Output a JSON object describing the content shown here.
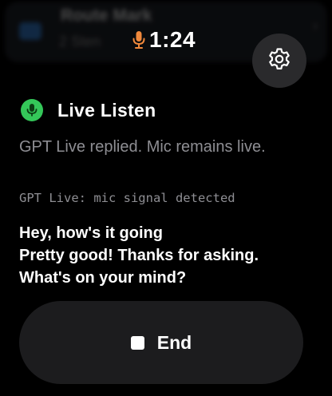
{
  "background_app": {
    "title": "Route Mark",
    "subtitle": "2 Sten",
    "chevron": "›"
  },
  "status": {
    "time": "1:24",
    "mic_icon": "microphone-icon",
    "mic_color": "#f0893c"
  },
  "settings": {
    "icon": "gear-icon"
  },
  "header": {
    "icon": "microphone-icon",
    "icon_color": "#34c759",
    "title": "Live Listen"
  },
  "status_message": "GPT Live replied. Mic remains live.",
  "debug_message": "GPT Live: mic signal detected",
  "transcript": [
    "Hey, how's it going",
    "Pretty good! Thanks for asking.",
    "What's on your mind?"
  ],
  "end_button": {
    "icon": "stop-icon",
    "label": "End"
  }
}
